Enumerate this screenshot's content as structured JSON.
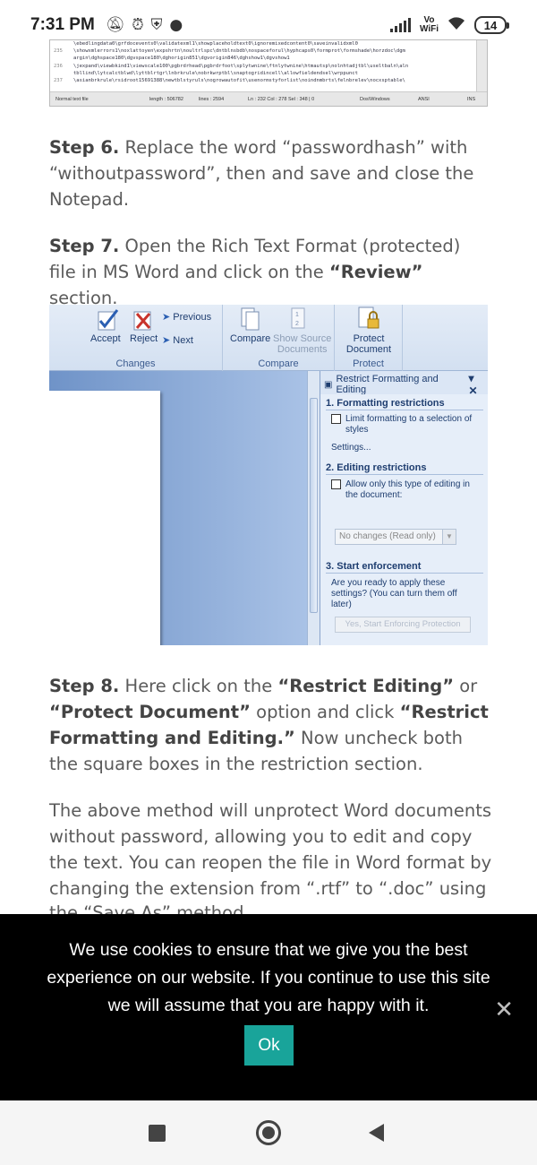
{
  "status_bar": {
    "time": "7:31 PM",
    "vowifi_top": "Vo",
    "vowifi_bottom": "WiFi",
    "battery": "14"
  },
  "notepad": {
    "lines": [
      {
        "num": "",
        "text": "\\ebedlingdata0\\grfdocevents0\\validatexml1\\showplaceholdtext0\\ignoremixedcontent0\\saveinvalidxml0"
      },
      {
        "num": "235",
        "text": "\\showxmlerrors1\\noxlattoyen\\expshrtn\\noultrlspc\\dntblnsbdb\\nospaceforul\\hyphcaps0\\formprot\\formshade\\horzdoc\\dgm"
      },
      {
        "num": "",
        "text": "argin\\dghspace180\\dgvspace180\\dghorigin851\\dgvorigin846\\dghshow1\\dgvshow1"
      },
      {
        "num": "236",
        "text": "\\jexpand\\viewbkind1\\viewscale100\\pgbrdrhead\\pgbrdrfoot\\splytwnine\\ftnlytwnine\\htmautsp\\nolnhtadjtbl\\useltbaln\\aln"
      },
      {
        "num": "",
        "text": "tbllind\\lytcalctblwd\\lyttblrtgr\\lnbrkrule\\nobrkwrptbl\\snaptogridincell\\allowfieldendsel\\wrppunct"
      },
      {
        "num": "237",
        "text": "\\asianbrkrule\\rsidroot15691388\\newtblstyruls\\nogrowautofit\\usenormstyforlist\\noindnmbrts\\felnbrelev\\nocxsptable\\"
      }
    ],
    "status": {
      "file_type": "Normal text file",
      "length": "length : 506782",
      "lines": "lines : 2594",
      "position": "Ln : 232    Col : 278    Sel : 348 | 0",
      "eol": "Dos\\Windows",
      "encoding": "ANSI",
      "mode": "INS"
    }
  },
  "article": {
    "step6_label": "Step 6.",
    "step6_text": " Replace the word “passwordhash” with “withoutpassword”, then and save and close the Notepad.",
    "step7_label": "Step 7.",
    "step7_text_a": " Open the Rich Text Format (protected) file in MS Word and click on the ",
    "step7_bold": "“Review”",
    "step7_text_b": " section.",
    "step8_label": "Step 8.",
    "step8_text_a": " Here click on the ",
    "step8_bold_a": "“Restrict Editing”",
    "step8_text_b": " or ",
    "step8_bold_b": "“Protect Document”",
    "step8_text_c": " option and click ",
    "step8_bold_c": "“Restrict Formatting and Editing.”",
    "step8_text_d": " Now uncheck both the square boxes in the restriction section.",
    "conclusion": "The above method will unprotect Word documents without password, allowing you to edit and copy the text. You can reopen the file in Word format by changing the extension from “.rtf” to “.doc” using",
    "peek": "the “Save As” method."
  },
  "word_ribbon": {
    "accept": "Accept",
    "reject": "Reject",
    "previous": "Previous",
    "next": "Next",
    "group_changes": "Changes",
    "compare": "Compare",
    "show_source_1": "Show Source",
    "show_source_2": "Documents",
    "group_compare": "Compare",
    "protect_1": "Protect",
    "protect_2": "Document",
    "group_protect": "Protect"
  },
  "restrict_pane": {
    "title": "Restrict Formatting and Editing",
    "section1": "1. Formatting restrictions",
    "limit_formatting": "Limit formatting to a selection of styles",
    "settings_link": "Settings...",
    "section2": "2. Editing restrictions",
    "allow_editing": "Allow only this type of editing in the document:",
    "editing_option": "No changes (Read only)",
    "section3": "3. Start enforcement",
    "enforce_question": "Are you ready to apply these settings? (You can turn them off later)",
    "enforce_button": "Yes, Start Enforcing Protection"
  },
  "cookie_banner": {
    "message": "We use cookies to ensure that we give you the best experience on our website. If you continue to use this site we will assume that you are happy with it.",
    "ok_label": "Ok",
    "close_glyph": "✕"
  },
  "colors": {
    "accent_ok": "#19a49a",
    "banner_bg": "#000000",
    "word_blue": "#1e3d6f"
  }
}
